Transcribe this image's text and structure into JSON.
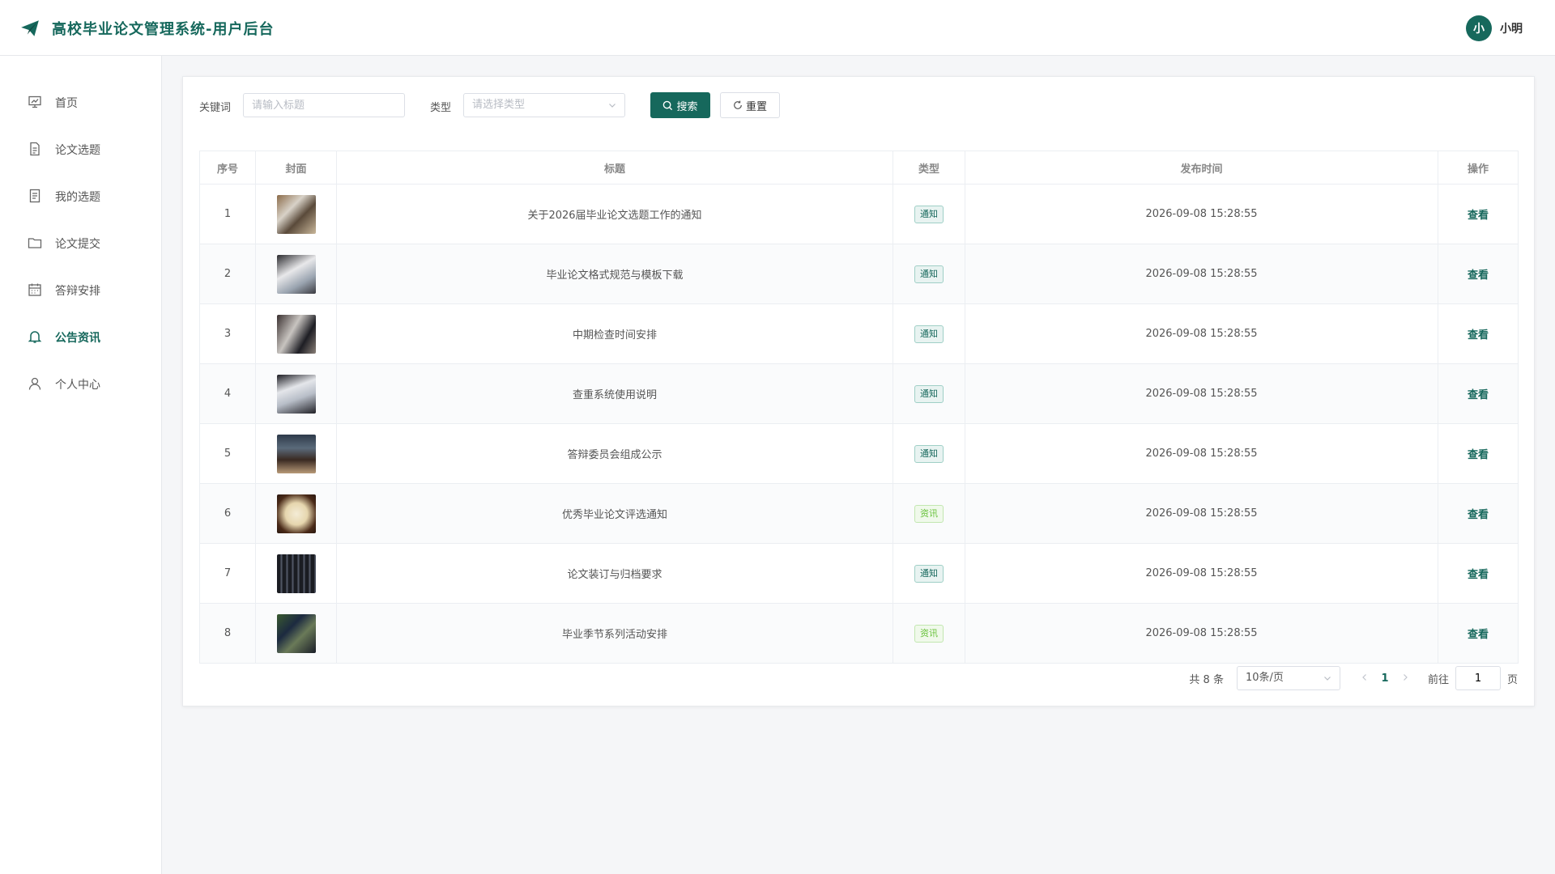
{
  "app": {
    "title": "高校毕业论文管理系统-用户后台"
  },
  "user": {
    "avatar_text": "小",
    "name": "小明"
  },
  "sidebar": {
    "items": [
      {
        "label": "首页",
        "icon": "dashboard-icon"
      },
      {
        "label": "论文选题",
        "icon": "document-icon"
      },
      {
        "label": "我的选题",
        "icon": "list-document-icon"
      },
      {
        "label": "论文提交",
        "icon": "folder-icon"
      },
      {
        "label": "答辩安排",
        "icon": "calendar-icon"
      },
      {
        "label": "公告资讯",
        "icon": "bell-icon",
        "active": true
      },
      {
        "label": "个人中心",
        "icon": "user-icon"
      }
    ]
  },
  "filters": {
    "keyword_label": "关键词",
    "keyword_placeholder": "请输入标题",
    "keyword_value": "",
    "type_label": "类型",
    "type_placeholder": "请选择类型",
    "search_label": "搜索",
    "reset_label": "重置"
  },
  "table": {
    "headers": [
      "序号",
      "封面",
      "标题",
      "类型",
      "发布时间",
      "操作"
    ],
    "rows": [
      {
        "index": "1",
        "title": "关于2026届毕业论文选题工作的通知",
        "type": "通知",
        "time": "2026-09-08 15:28:55",
        "action": "查看"
      },
      {
        "index": "2",
        "title": "毕业论文格式规范与模板下载",
        "type": "通知",
        "time": "2026-09-08 15:28:55",
        "action": "查看"
      },
      {
        "index": "3",
        "title": "中期检查时间安排",
        "type": "通知",
        "time": "2026-09-08 15:28:55",
        "action": "查看"
      },
      {
        "index": "4",
        "title": "查重系统使用说明",
        "type": "通知",
        "time": "2026-09-08 15:28:55",
        "action": "查看"
      },
      {
        "index": "5",
        "title": "答辩委员会组成公示",
        "type": "通知",
        "time": "2026-09-08 15:28:55",
        "action": "查看"
      },
      {
        "index": "6",
        "title": "优秀毕业论文评选通知",
        "type": "资讯",
        "time": "2026-09-08 15:28:55",
        "action": "查看"
      },
      {
        "index": "7",
        "title": "论文装订与归档要求",
        "type": "通知",
        "time": "2026-09-08 15:28:55",
        "action": "查看"
      },
      {
        "index": "8",
        "title": "毕业季节系列活动安排",
        "type": "资讯",
        "time": "2026-09-08 15:28:55",
        "action": "查看"
      }
    ]
  },
  "pagination": {
    "total_text": "共 8 条",
    "page_size": "10条/页",
    "current_page": "1",
    "goto_label": "前往",
    "goto_value": "1",
    "page_suffix": "页"
  },
  "colors": {
    "primary": "#16685c",
    "news_tag": "#67c23a"
  }
}
